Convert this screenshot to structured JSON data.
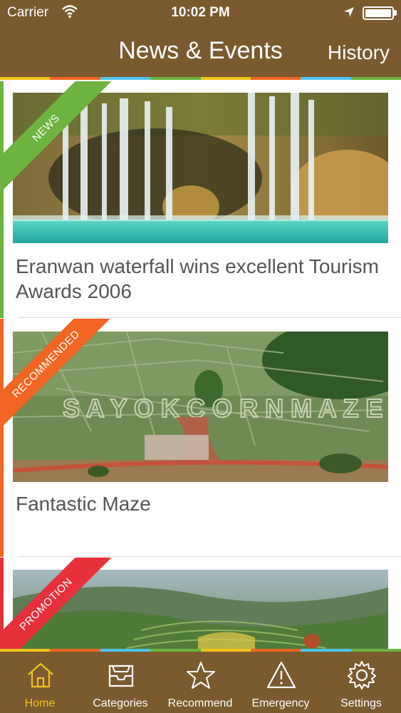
{
  "status_bar": {
    "carrier": "Carrier",
    "time": "10:02 PM"
  },
  "nav": {
    "title": "News & Events",
    "history_label": "History"
  },
  "cards": [
    {
      "tag": "NEWS",
      "tag_color": "#6db33f",
      "title": "Eranwan waterfall wins excellent Tourism Awards 2006",
      "image": "waterfall-photo"
    },
    {
      "tag": "RECOMMENDED",
      "tag_color": "#f26522",
      "title": "Fantastic Maze",
      "image": "corn-maze-photo"
    },
    {
      "tag": "PROMOTION",
      "tag_color": "#e8303b",
      "title": "",
      "image": "rice-terraces-photo"
    }
  ],
  "tabs": [
    {
      "label": "Home",
      "icon": "home-icon",
      "active": true
    },
    {
      "label": "Categories",
      "icon": "inbox-icon",
      "active": false
    },
    {
      "label": "Recommend",
      "icon": "star-icon",
      "active": false
    },
    {
      "label": "Emergency",
      "icon": "warning-icon",
      "active": false
    },
    {
      "label": "Settings",
      "icon": "gear-icon",
      "active": false
    }
  ],
  "colors": {
    "brand_brown": "#7a5a2e",
    "active_tab": "#f0c419",
    "stripe": [
      "#f0c419",
      "#f26522",
      "#4fc3f7",
      "#6db33f",
      "#f0c419",
      "#f26522",
      "#4fc3f7",
      "#6db33f"
    ]
  }
}
